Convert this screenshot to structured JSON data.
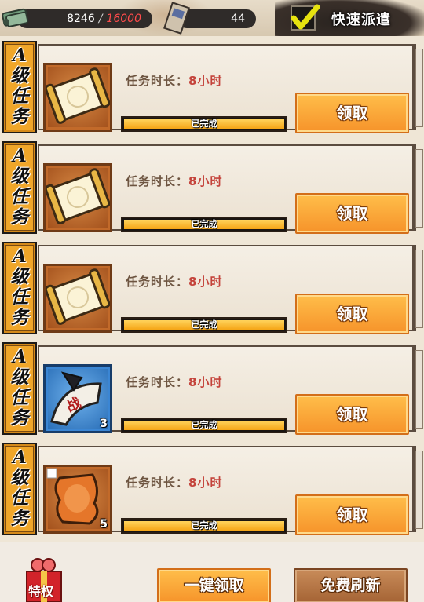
{
  "top_bar": {
    "resource1": {
      "icon": "scroll-stack-icon",
      "current": "8246",
      "separator": "/",
      "max": "16000"
    },
    "resource2": {
      "icon": "ticket-icon",
      "value": "44"
    },
    "quick_dispatch": {
      "label": "快速派遣",
      "checked": true
    }
  },
  "tasks": [
    {
      "tag": "A级任务",
      "tag_glyphs": [
        "A",
        "级",
        "任",
        "务"
      ],
      "duration_label": "任务时长：",
      "duration_value": "8小时",
      "status": "已完成",
      "progress": 1.0,
      "claim_label": "领取",
      "item": "scroll",
      "count": ""
    },
    {
      "tag": "A级任务",
      "tag_glyphs": [
        "A",
        "级",
        "任",
        "务"
      ],
      "duration_label": "任务时长：",
      "duration_value": "8小时",
      "status": "已完成",
      "progress": 1.0,
      "claim_label": "领取",
      "item": "scroll",
      "count": ""
    },
    {
      "tag": "A级任务",
      "tag_glyphs": [
        "A",
        "级",
        "任",
        "务"
      ],
      "duration_label": "任务时长：",
      "duration_value": "8小时",
      "status": "已完成",
      "progress": 1.0,
      "claim_label": "领取",
      "item": "scroll",
      "count": ""
    },
    {
      "tag": "A级任务",
      "tag_glyphs": [
        "A",
        "级",
        "任",
        "务"
      ],
      "duration_label": "任务时长：",
      "duration_value": "8小时",
      "status": "已完成",
      "progress": 1.0,
      "claim_label": "领取",
      "item": "battle-scroll",
      "item_text": "战",
      "count": "3"
    },
    {
      "tag": "A级任务",
      "tag_glyphs": [
        "A",
        "级",
        "任",
        "务"
      ],
      "duration_label": "任务时长：",
      "duration_value": "8小时",
      "status": "已完成",
      "progress": 1.0,
      "claim_label": "领取",
      "item": "puzzle-shard",
      "count": "5"
    }
  ],
  "bottom_bar": {
    "privilege_label": "特权",
    "claim_all_label": "一键领取",
    "free_refresh_label": "免费刷新"
  },
  "colors": {
    "accent_orange": "#f6932a",
    "tag_orange": "#f0a629",
    "red_text": "#c4433b",
    "max_red": "#ff4b4b"
  }
}
